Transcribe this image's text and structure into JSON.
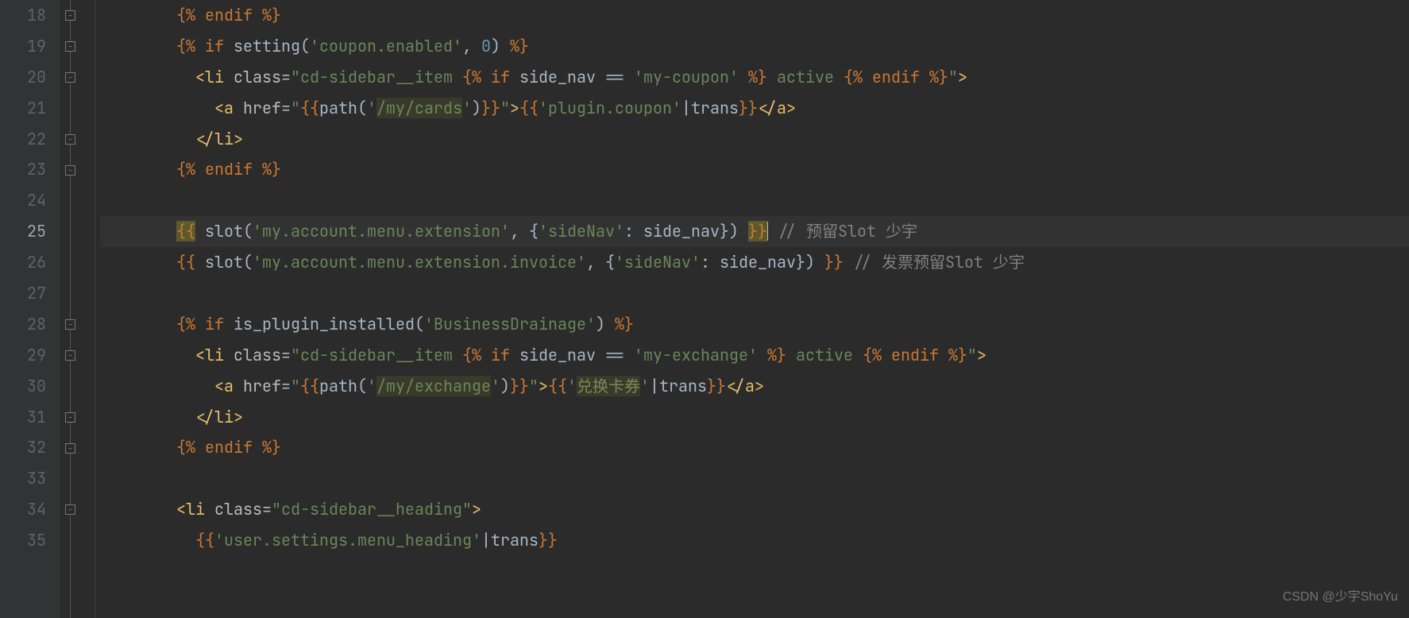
{
  "watermark": "CSDN @少宇ShoYu",
  "gutter": {
    "start": 18,
    "end": 35,
    "active": 25
  },
  "lines": {
    "18": [
      {
        "t": "        ",
        "c": "c-default"
      },
      {
        "t": "{% ",
        "c": "c-delim"
      },
      {
        "t": "endif",
        "c": "c-kw"
      },
      {
        "t": " %}",
        "c": "c-delim"
      }
    ],
    "19": [
      {
        "t": "        ",
        "c": "c-default"
      },
      {
        "t": "{% ",
        "c": "c-delim"
      },
      {
        "t": "if",
        "c": "c-kw"
      },
      {
        "t": " ",
        "c": "c-default"
      },
      {
        "t": "setting",
        "c": "c-fn"
      },
      {
        "t": "(",
        "c": "c-default"
      },
      {
        "t": "'coupon.enabled'",
        "c": "c-str"
      },
      {
        "t": ", ",
        "c": "c-default"
      },
      {
        "t": "0",
        "c": "c-num"
      },
      {
        "t": ") ",
        "c": "c-default"
      },
      {
        "t": "%}",
        "c": "c-delim"
      }
    ],
    "20": [
      {
        "t": "          ",
        "c": "c-default"
      },
      {
        "t": "<li ",
        "c": "c-tag"
      },
      {
        "t": "class",
        "c": "c-attr"
      },
      {
        "t": "=",
        "c": "c-default"
      },
      {
        "t": "\"cd-sidebar__item ",
        "c": "c-str"
      },
      {
        "t": "{% ",
        "c": "c-delim"
      },
      {
        "t": "if",
        "c": "c-kw"
      },
      {
        "t": " side_nav == ",
        "c": "c-default"
      },
      {
        "t": "'my-coupon'",
        "c": "c-str"
      },
      {
        "t": " ",
        "c": "c-default"
      },
      {
        "t": "%}",
        "c": "c-delim"
      },
      {
        "t": " active ",
        "c": "c-str"
      },
      {
        "t": "{% ",
        "c": "c-delim"
      },
      {
        "t": "endif",
        "c": "c-kw"
      },
      {
        "t": " %}",
        "c": "c-delim"
      },
      {
        "t": "\"",
        "c": "c-str"
      },
      {
        "t": ">",
        "c": "c-tag"
      }
    ],
    "21": [
      {
        "t": "            ",
        "c": "c-default"
      },
      {
        "t": "<a ",
        "c": "c-tag"
      },
      {
        "t": "href",
        "c": "c-attr"
      },
      {
        "t": "=",
        "c": "c-default"
      },
      {
        "t": "\"",
        "c": "c-str"
      },
      {
        "t": "{{",
        "c": "c-delim"
      },
      {
        "t": "path(",
        "c": "c-default"
      },
      {
        "t": "'",
        "c": "c-str"
      },
      {
        "t": "/my/cards",
        "c": "c-str-hl"
      },
      {
        "t": "'",
        "c": "c-str"
      },
      {
        "t": ")",
        "c": "c-default"
      },
      {
        "t": "}}",
        "c": "c-delim"
      },
      {
        "t": "\"",
        "c": "c-str"
      },
      {
        "t": ">",
        "c": "c-tag"
      },
      {
        "t": "{{",
        "c": "c-delim"
      },
      {
        "t": "'plugin.coupon'",
        "c": "c-str"
      },
      {
        "t": "|",
        "c": "c-op"
      },
      {
        "t": "trans",
        "c": "c-filter"
      },
      {
        "t": "}}",
        "c": "c-delim"
      },
      {
        "t": "</a>",
        "c": "c-tag"
      }
    ],
    "22": [
      {
        "t": "          ",
        "c": "c-default"
      },
      {
        "t": "</li>",
        "c": "c-tag"
      }
    ],
    "23": [
      {
        "t": "        ",
        "c": "c-default"
      },
      {
        "t": "{% ",
        "c": "c-delim"
      },
      {
        "t": "endif",
        "c": "c-kw"
      },
      {
        "t": " %}",
        "c": "c-delim"
      }
    ],
    "24": [
      {
        "t": "",
        "c": "c-default"
      }
    ],
    "25": [
      {
        "t": "        ",
        "c": "c-default"
      },
      {
        "t": "{{",
        "c": "c-delim-hl"
      },
      {
        "t": " slot(",
        "c": "c-default"
      },
      {
        "t": "'my.account.menu.extension'",
        "c": "c-str"
      },
      {
        "t": ", {",
        "c": "c-default"
      },
      {
        "t": "'sideNav'",
        "c": "c-str"
      },
      {
        "t": ": side_nav}) ",
        "c": "c-default"
      },
      {
        "t": "}}",
        "c": "c-delim-hl"
      },
      {
        "caret": true
      },
      {
        "t": " ",
        "c": "c-default"
      },
      {
        "t": "// 预留Slot 少宇",
        "c": "c-cmt"
      }
    ],
    "26": [
      {
        "t": "        ",
        "c": "c-default"
      },
      {
        "t": "{{",
        "c": "c-delim"
      },
      {
        "t": " slot(",
        "c": "c-default"
      },
      {
        "t": "'my.account.menu.extension.invoice'",
        "c": "c-str"
      },
      {
        "t": ", {",
        "c": "c-default"
      },
      {
        "t": "'sideNav'",
        "c": "c-str"
      },
      {
        "t": ": side_nav}) ",
        "c": "c-default"
      },
      {
        "t": "}}",
        "c": "c-delim"
      },
      {
        "t": " ",
        "c": "c-default"
      },
      {
        "t": "// 发票预留Slot 少宇",
        "c": "c-cmt"
      }
    ],
    "27": [
      {
        "t": "",
        "c": "c-default"
      }
    ],
    "28": [
      {
        "t": "        ",
        "c": "c-default"
      },
      {
        "t": "{% ",
        "c": "c-delim"
      },
      {
        "t": "if",
        "c": "c-kw"
      },
      {
        "t": " is_plugin_installed(",
        "c": "c-default"
      },
      {
        "t": "'BusinessDrainage'",
        "c": "c-str"
      },
      {
        "t": ") ",
        "c": "c-default"
      },
      {
        "t": "%}",
        "c": "c-delim"
      }
    ],
    "29": [
      {
        "t": "          ",
        "c": "c-default"
      },
      {
        "t": "<li ",
        "c": "c-tag"
      },
      {
        "t": "class",
        "c": "c-attr"
      },
      {
        "t": "=",
        "c": "c-default"
      },
      {
        "t": "\"cd-sidebar__item ",
        "c": "c-str"
      },
      {
        "t": "{% ",
        "c": "c-delim"
      },
      {
        "t": "if",
        "c": "c-kw"
      },
      {
        "t": " side_nav == ",
        "c": "c-default"
      },
      {
        "t": "'my-exchange'",
        "c": "c-str"
      },
      {
        "t": " ",
        "c": "c-default"
      },
      {
        "t": "%}",
        "c": "c-delim"
      },
      {
        "t": " active ",
        "c": "c-str"
      },
      {
        "t": "{% ",
        "c": "c-delim"
      },
      {
        "t": "endif",
        "c": "c-kw"
      },
      {
        "t": " %}",
        "c": "c-delim"
      },
      {
        "t": "\"",
        "c": "c-str"
      },
      {
        "t": ">",
        "c": "c-tag"
      }
    ],
    "30": [
      {
        "t": "            ",
        "c": "c-default"
      },
      {
        "t": "<a ",
        "c": "c-tag"
      },
      {
        "t": "href",
        "c": "c-attr"
      },
      {
        "t": "=",
        "c": "c-default"
      },
      {
        "t": "\"",
        "c": "c-str"
      },
      {
        "t": "{{",
        "c": "c-delim"
      },
      {
        "t": "path(",
        "c": "c-default"
      },
      {
        "t": "'",
        "c": "c-str"
      },
      {
        "t": "/my/exchange",
        "c": "c-str-hl"
      },
      {
        "t": "'",
        "c": "c-str"
      },
      {
        "t": ")",
        "c": "c-default"
      },
      {
        "t": "}}",
        "c": "c-delim"
      },
      {
        "t": "\"",
        "c": "c-str"
      },
      {
        "t": ">",
        "c": "c-tag"
      },
      {
        "t": "{{",
        "c": "c-delim"
      },
      {
        "t": "'",
        "c": "c-str"
      },
      {
        "t": "兑换卡券",
        "c": "c-cn hl-path"
      },
      {
        "t": "'",
        "c": "c-str"
      },
      {
        "t": "|",
        "c": "c-op"
      },
      {
        "t": "trans",
        "c": "c-filter"
      },
      {
        "t": "}}",
        "c": "c-delim"
      },
      {
        "t": "</a>",
        "c": "c-tag"
      }
    ],
    "31": [
      {
        "t": "          ",
        "c": "c-default"
      },
      {
        "t": "</li>",
        "c": "c-tag"
      }
    ],
    "32": [
      {
        "t": "        ",
        "c": "c-default"
      },
      {
        "t": "{% ",
        "c": "c-delim"
      },
      {
        "t": "endif",
        "c": "c-kw"
      },
      {
        "t": " %}",
        "c": "c-delim"
      }
    ],
    "33": [
      {
        "t": "",
        "c": "c-default"
      }
    ],
    "34": [
      {
        "t": "        ",
        "c": "c-default"
      },
      {
        "t": "<li ",
        "c": "c-tag"
      },
      {
        "t": "class",
        "c": "c-attr"
      },
      {
        "t": "=",
        "c": "c-default"
      },
      {
        "t": "\"cd-sidebar__heading\"",
        "c": "c-str"
      },
      {
        "t": ">",
        "c": "c-tag"
      }
    ],
    "35": [
      {
        "t": "          ",
        "c": "c-default"
      },
      {
        "t": "{{",
        "c": "c-delim"
      },
      {
        "t": "'user.settings.menu_heading'",
        "c": "c-str"
      },
      {
        "t": "|",
        "c": "c-op"
      },
      {
        "t": "trans",
        "c": "c-filter"
      },
      {
        "t": "}}",
        "c": "c-delim"
      }
    ]
  },
  "fold_markers": [
    {
      "line": 18,
      "kind": "close"
    },
    {
      "line": 19,
      "kind": "open"
    },
    {
      "line": 20,
      "kind": "open"
    },
    {
      "line": 22,
      "kind": "close"
    },
    {
      "line": 23,
      "kind": "close"
    },
    {
      "line": 28,
      "kind": "open"
    },
    {
      "line": 29,
      "kind": "open"
    },
    {
      "line": 31,
      "kind": "close"
    },
    {
      "line": 32,
      "kind": "close"
    },
    {
      "line": 34,
      "kind": "open"
    }
  ]
}
